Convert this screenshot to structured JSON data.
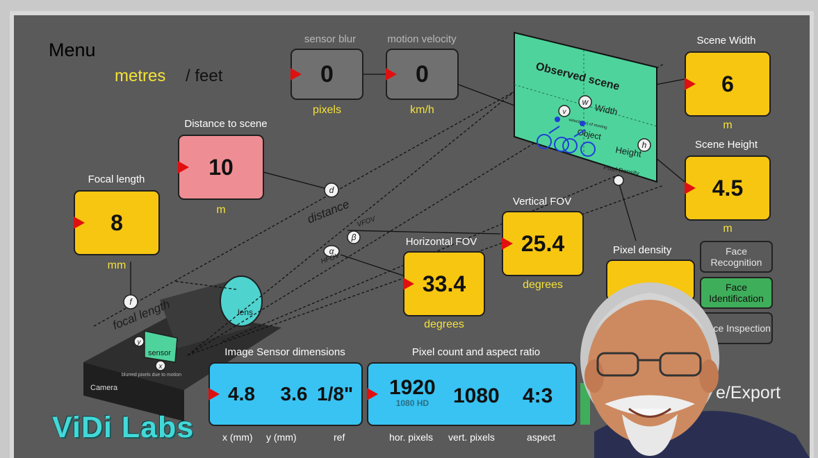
{
  "menu": {
    "label": "Menu"
  },
  "units": {
    "metres": "metres",
    "feet": "/ feet"
  },
  "sensor_blur": {
    "label": "sensor blur",
    "value": "0",
    "unit": "pixels"
  },
  "motion_velocity": {
    "label": "motion velocity",
    "value": "0",
    "unit": "km/h"
  },
  "distance": {
    "label": "Distance to scene",
    "value": "10",
    "unit": "m"
  },
  "focal_length": {
    "label": "Focal length",
    "value": "8",
    "unit": "mm"
  },
  "scene_width": {
    "label": "Scene Width",
    "value": "6",
    "unit": "m"
  },
  "scene_height": {
    "label": "Scene Height",
    "value": "4.5",
    "unit": "m"
  },
  "vertical_fov": {
    "label": "Vertical FOV",
    "value": "25.4",
    "unit": "degrees"
  },
  "horizontal_fov": {
    "label": "Horizontal FOV",
    "value": "33.4",
    "unit": "degrees"
  },
  "pixel_density": {
    "label": "Pixel density"
  },
  "face_buttons": [
    {
      "label": "Face Recognition",
      "color": "#5a5a5a"
    },
    {
      "label": "Face Identification",
      "color": "#3fae5a"
    },
    {
      "label": "Face Inspection",
      "color": "#5a5a5a"
    }
  ],
  "image_sensor": {
    "label": "Image Sensor dimensions",
    "x": "4.8",
    "y": "3.6",
    "ref": "1/8\"",
    "x_label": "x (mm)",
    "y_label": "y (mm)",
    "ref_label": "ref"
  },
  "pixel_count": {
    "label": "Pixel count and aspect ratio",
    "h": "1920",
    "hd": "1080 HD",
    "v": "1080",
    "aspect": "4:3",
    "h_label": "hor. pixels",
    "v_label": "vert. pixels",
    "aspect_label": "aspect"
  },
  "export_label": "e/Export",
  "brand": "ViDi Labs",
  "diagram": {
    "observed_scene": "Observed scene",
    "width": "Width",
    "height": "Height",
    "object": "Object",
    "velocity_note": "velocity (v) of moving",
    "pixel_density": "Pixel Density",
    "distance": "distance",
    "focal_length": "focal length",
    "lens": "lens",
    "sensor": "sensor",
    "camera": "Camera",
    "blur_note": "blurred pixels due to motion",
    "vfov": "VFOV",
    "hfov": "HFOV",
    "sym_d": "d",
    "sym_f": "f",
    "sym_w": "w",
    "sym_h": "h",
    "sym_v": "v",
    "sym_b": "β",
    "sym_a": "α",
    "sym_y": "y",
    "sym_x": "x"
  },
  "colors": {
    "accent_yellow": "#f7c611",
    "accent_blue": "#38c3f2",
    "accent_pink": "#ee8d93",
    "scene_green": "#4fd39c"
  }
}
